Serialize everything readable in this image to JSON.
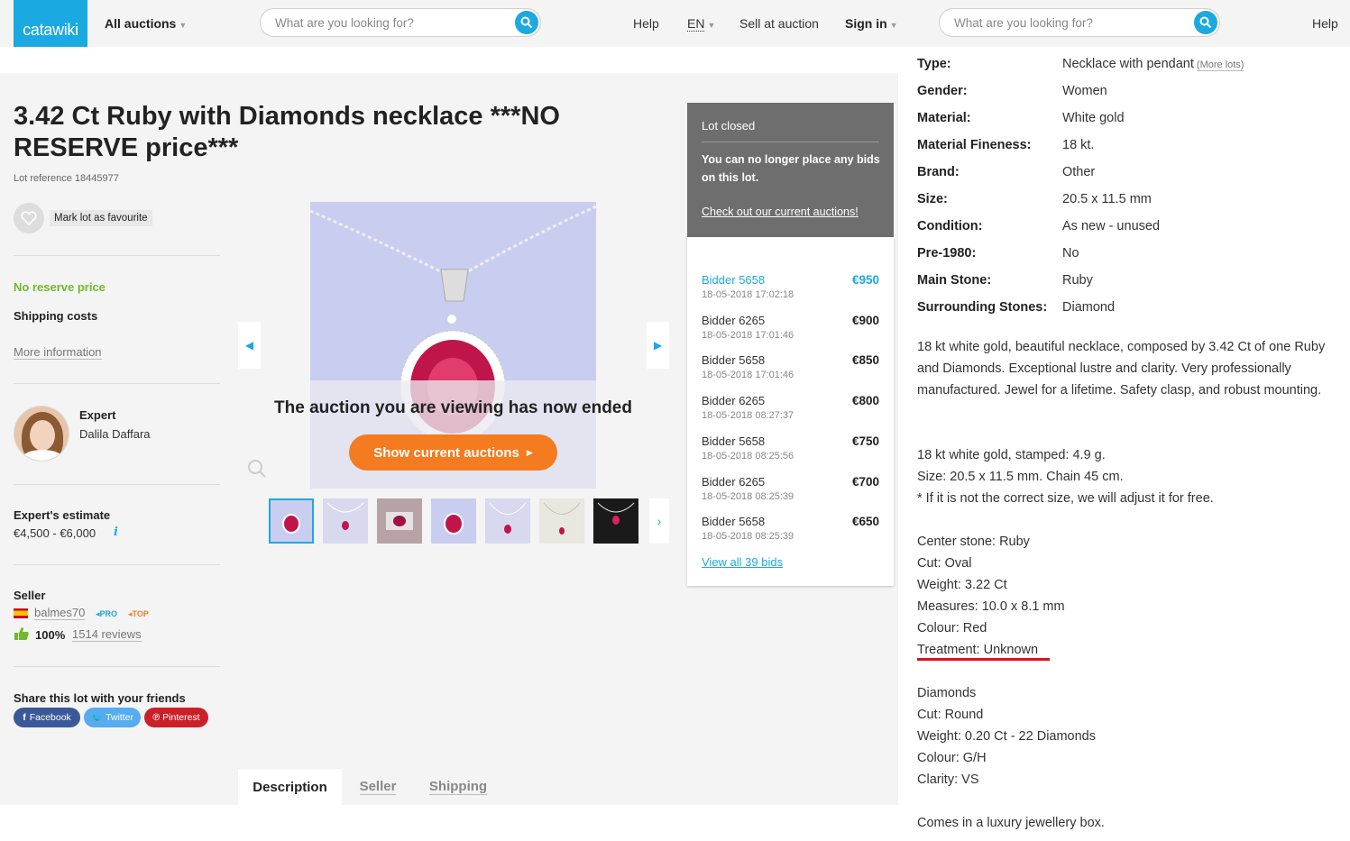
{
  "header": {
    "logo": "catawiki",
    "all_auctions": "All auctions",
    "search_placeholder": "What are you looking for?",
    "help": "Help",
    "lang": "EN",
    "sell": "Sell at auction",
    "signin": "Sign in",
    "right_search_placeholder": "What are you looking for?",
    "right_help": "Help"
  },
  "lot": {
    "title": "3.42 Ct Ruby with Diamonds necklace ***NO RESERVE price***",
    "reference": "Lot reference 18445977",
    "favourite": "Mark lot as favourite",
    "no_reserve": "No reserve price",
    "shipping_costs": "Shipping costs",
    "more_info": "More information",
    "expert_label": "Expert",
    "expert_name": "Dalila Daffara",
    "estimate_label": "Expert's estimate",
    "estimate_value": "€4,500 - €6,000",
    "seller_label": "Seller",
    "seller_name": "balmes70",
    "badge_pro": "PRO",
    "badge_top": "TOP",
    "rating": "100%",
    "reviews": "1514 reviews",
    "share_label": "Share this lot with your friends",
    "share": {
      "facebook": "Facebook",
      "twitter": "Twitter",
      "pinterest": "Pinterest"
    }
  },
  "gallery": {
    "ended_text": "The auction you are viewing has now ended",
    "show_current": "Show current auctions"
  },
  "bids_panel": {
    "status": "Lot closed",
    "message": "You can no longer place any bids on this lot.",
    "link": "Check out our current auctions!",
    "bids": [
      {
        "bidder": "Bidder 5658",
        "date": "18-05-2018 17:02:18",
        "amount": "€950"
      },
      {
        "bidder": "Bidder 6265",
        "date": "18-05-2018 17:01:46",
        "amount": "€900"
      },
      {
        "bidder": "Bidder 5658",
        "date": "18-05-2018 17:01:46",
        "amount": "€850"
      },
      {
        "bidder": "Bidder 6265",
        "date": "18-05-2018 08:27:37",
        "amount": "€800"
      },
      {
        "bidder": "Bidder 5658",
        "date": "18-05-2018 08:25:56",
        "amount": "€750"
      },
      {
        "bidder": "Bidder 6265",
        "date": "18-05-2018 08:25:39",
        "amount": "€700"
      },
      {
        "bidder": "Bidder 5658",
        "date": "18-05-2018 08:25:39",
        "amount": "€650"
      }
    ],
    "view_all": "View all 39 bids"
  },
  "tabs": [
    "Description",
    "Seller",
    "Shipping"
  ],
  "specs": [
    {
      "key": "Type:",
      "value": "Necklace with pendant",
      "extra": "(More lots)"
    },
    {
      "key": "Gender:",
      "value": "Women"
    },
    {
      "key": "Material:",
      "value": "White gold"
    },
    {
      "key": "Material Fineness:",
      "value": "18 kt."
    },
    {
      "key": "Brand:",
      "value": "Other"
    },
    {
      "key": "Size:",
      "value": "20.5 x 11.5 mm"
    },
    {
      "key": "Condition:",
      "value": "As new - unused"
    },
    {
      "key": "Pre-1980:",
      "value": "No"
    },
    {
      "key": "Main Stone:",
      "value": "Ruby"
    },
    {
      "key": "Surrounding Stones:",
      "value": "Diamond"
    }
  ],
  "description": {
    "p1": "18 kt white gold, beautiful necklace, composed by 3.42 Ct of one Ruby and Diamonds. Exceptional lustre and clarity. Very professionally manufactured. Jewel for a lifetime. Safety clasp, and robust mounting.",
    "lines": [
      "18 kt white gold, stamped: 4.9 g.",
      "Size: 20.5 x 11.5 mm. Chain 45 cm.",
      "* If it is not the correct size, we will adjust it for free.",
      "",
      "Center stone: Ruby",
      "Cut: Oval",
      "Weight: 3.22 Ct",
      "Measures: 10.0 x 8.1 mm",
      "Colour: Red",
      "Treatment: Unknown",
      "",
      "Diamonds",
      "Cut: Round",
      "Weight: 0.20 Ct - 22 Diamonds",
      "Colour: G/H",
      "Clarity: VS",
      "",
      "Comes in a luxury jewellery box."
    ]
  },
  "colors": {
    "accent": "#1ba9e1",
    "orange": "#f47b20",
    "green": "#6fb92c",
    "highlight": "#e0101a"
  }
}
